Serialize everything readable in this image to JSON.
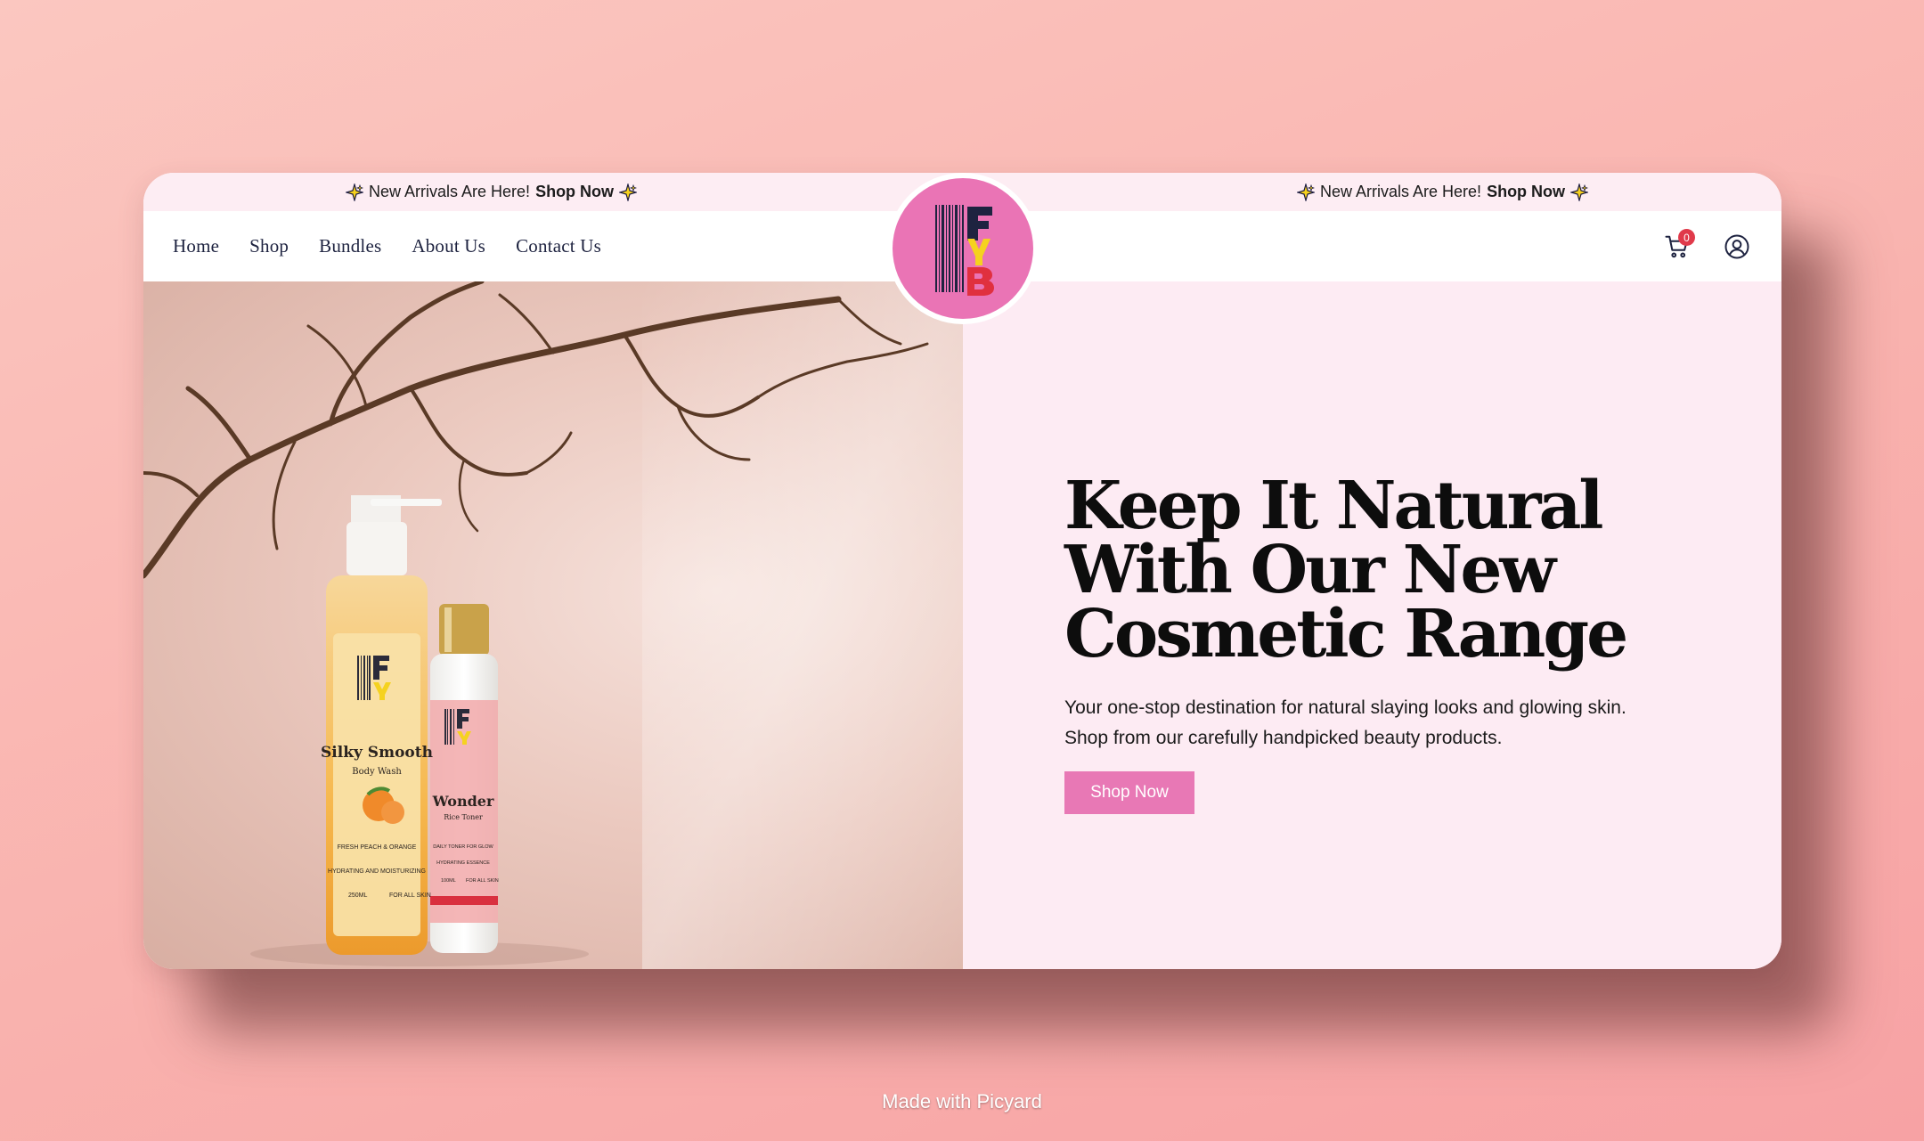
{
  "announcement": {
    "left": {
      "text": "New Arrivals Are Here!",
      "link": "Shop Now"
    },
    "right": {
      "text": "New Arrivals Are Here!",
      "link": "Shop Now"
    }
  },
  "nav": {
    "items": [
      {
        "label": "Home"
      },
      {
        "label": "Shop"
      },
      {
        "label": "Bundles"
      },
      {
        "label": "About Us"
      },
      {
        "label": "Contact Us"
      }
    ],
    "cart_count": "0",
    "cart_icon": "shopping-cart-icon",
    "account_icon": "user-account-icon"
  },
  "logo": {
    "text": "FYB",
    "brand_color": "#ea74b5"
  },
  "hero": {
    "headline": "Keep It Natural With Our New Cosmetic Range",
    "subtext_line1": "Your one-stop destination for natural slaying looks and glowing skin.",
    "subtext_line2": "Shop from our carefully handpicked beauty products.",
    "cta_label": "Shop Now",
    "accent_color": "#e878b5",
    "panel_color": "#fdebf3"
  },
  "products": {
    "bottle1": {
      "name": "Silky Smooth",
      "type": "Body Wash",
      "note1": "FRESH PEACH & ORANGE",
      "note2": "HYDRATING AND MOISTURIZING",
      "size": "250ML",
      "skin": "FOR ALL SKIN"
    },
    "bottle2": {
      "name": "Wonder",
      "type": "Rice Toner",
      "note1": "DAILY TONER FOR GLOW",
      "note2": "HYDRATING ESSENCE",
      "size": "100ML",
      "skin": "FOR ALL SKIN"
    }
  },
  "watermark": "Made with Picyard"
}
